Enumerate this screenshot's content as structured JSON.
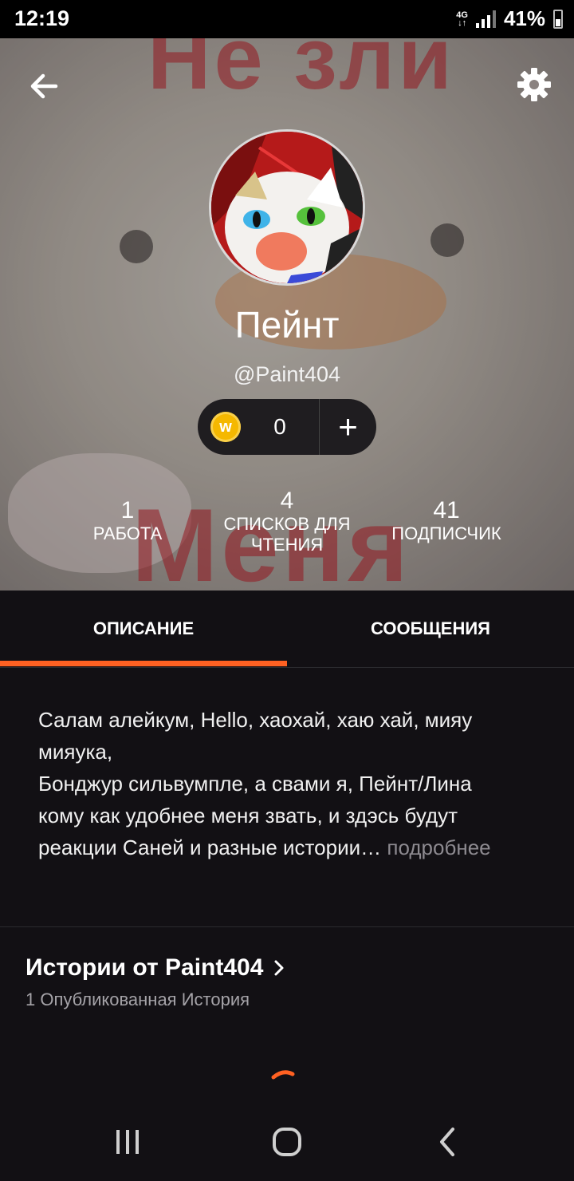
{
  "status_bar": {
    "time": "12:19",
    "network": "4G",
    "battery": "41%"
  },
  "header": {
    "background_text_top": "Не зли",
    "background_text_bottom": "Меня",
    "back_icon": "arrow-left-icon",
    "settings_icon": "gear-icon"
  },
  "profile": {
    "display_name": "Пейнт",
    "username": "@Paint404",
    "coins": "0",
    "coin_icon": "w",
    "add_label": "+"
  },
  "stats": [
    {
      "number": "1",
      "label": "Работа"
    },
    {
      "number": "4",
      "label": "Списков для чтения"
    },
    {
      "number": "41",
      "label": "Подписчик"
    }
  ],
  "tabs": [
    {
      "label": "ОПИСАНИЕ",
      "active": true
    },
    {
      "label": "СООБЩЕНИЯ",
      "active": false
    }
  ],
  "description": {
    "lines": [
      "Салам алейкум, Hello, хаохай, хаю хай, мияу",
      "мияука,",
      "Бонджур сильвумпле, а свами я, Пейнт/Лина",
      "кому как удобнее меня звать, и здэсь будут",
      "реакции Саней и разные истории…"
    ],
    "read_more": "подробнее"
  },
  "stories": {
    "title": "Истории от Paint404",
    "subtitle": "1 Опубликованная История"
  },
  "colors": {
    "accent": "#ff6122",
    "background": "#121014"
  }
}
